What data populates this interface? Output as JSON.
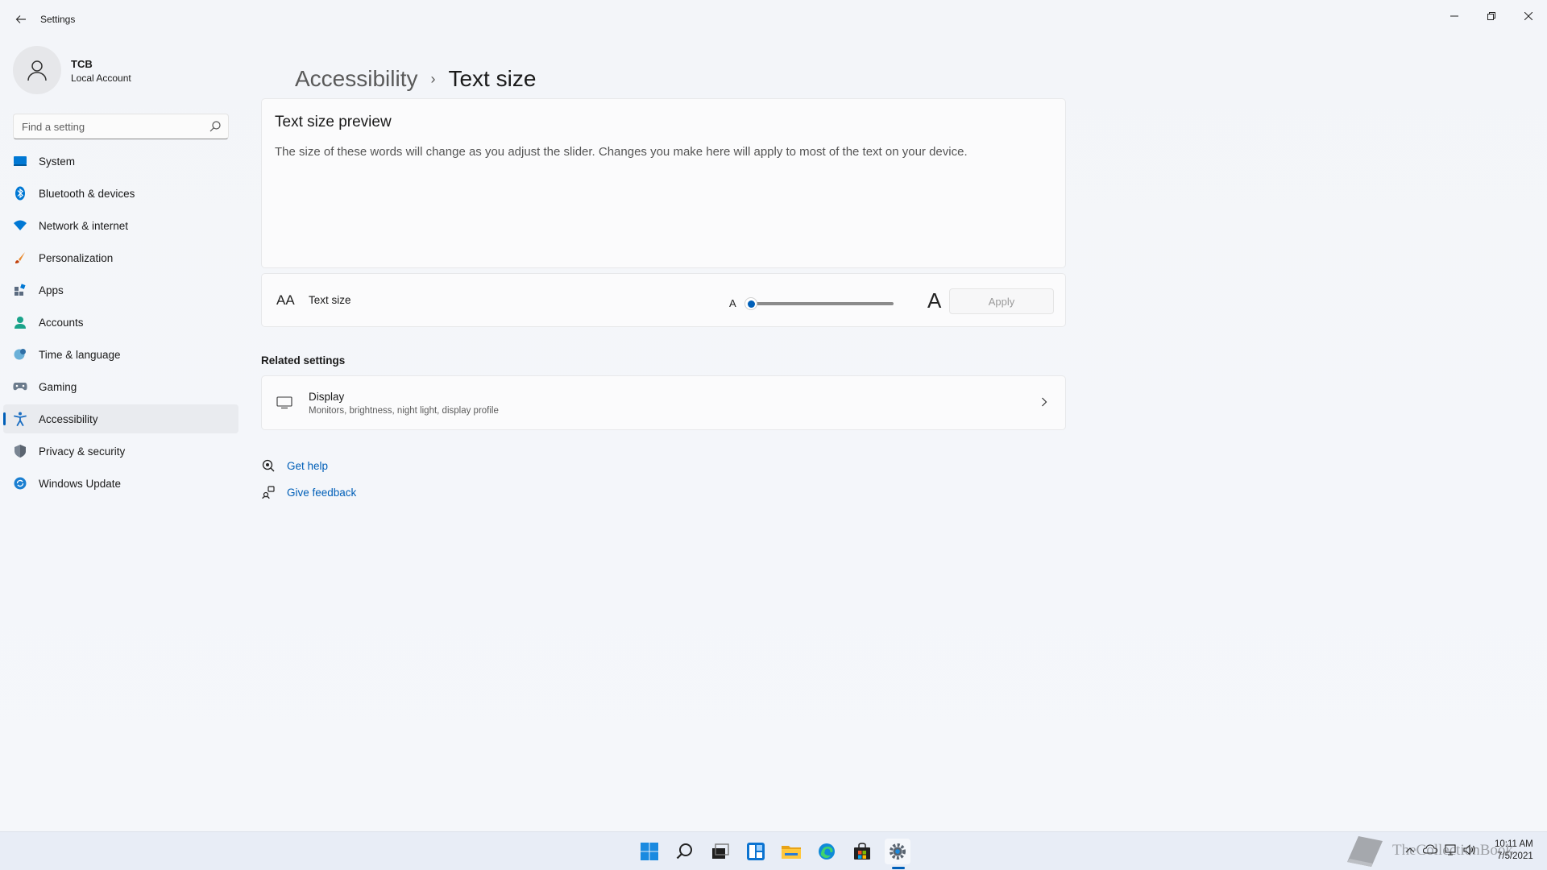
{
  "window": {
    "app_title": "Settings"
  },
  "profile": {
    "name": "TCB",
    "account_type": "Local Account"
  },
  "search": {
    "placeholder": "Find a setting"
  },
  "sidebar": {
    "items": [
      {
        "label": "System",
        "icon": "system-icon"
      },
      {
        "label": "Bluetooth & devices",
        "icon": "bluetooth-icon"
      },
      {
        "label": "Network & internet",
        "icon": "wifi-icon"
      },
      {
        "label": "Personalization",
        "icon": "brush-icon"
      },
      {
        "label": "Apps",
        "icon": "apps-icon"
      },
      {
        "label": "Accounts",
        "icon": "person-icon"
      },
      {
        "label": "Time & language",
        "icon": "globe-clock-icon"
      },
      {
        "label": "Gaming",
        "icon": "gamepad-icon"
      },
      {
        "label": "Accessibility",
        "icon": "accessibility-icon",
        "active": true
      },
      {
        "label": "Privacy & security",
        "icon": "shield-icon"
      },
      {
        "label": "Windows Update",
        "icon": "update-icon"
      }
    ]
  },
  "breadcrumb": {
    "parent": "Accessibility",
    "separator": "›",
    "current": "Text size"
  },
  "preview": {
    "title": "Text size preview",
    "text": "The size of these words will change as you adjust the slider. Changes you make here will apply to most of the text on your device."
  },
  "text_size": {
    "icon_glyph": "AA",
    "label": "Text size",
    "slider_min_glyph": "A",
    "slider_max_glyph": "A",
    "slider_value_fraction": 0.0,
    "apply_label": "Apply"
  },
  "related": {
    "heading": "Related settings",
    "display": {
      "title": "Display",
      "subtitle": "Monitors, brightness, night light, display profile"
    }
  },
  "help": {
    "get_help": "Get help",
    "give_feedback": "Give feedback"
  },
  "taskbar": {
    "apps": [
      "start-icon",
      "search-icon",
      "task-view-icon",
      "widgets-icon",
      "file-explorer-icon",
      "edge-icon",
      "store-icon",
      "settings-icon"
    ],
    "active_app": "settings-icon",
    "time": "10:11 AM",
    "date": "7/5/2021"
  },
  "watermark": {
    "text": "TheCollectionBook"
  },
  "colors": {
    "accent": "#005fb8",
    "background": "#f3f5f9",
    "card": "#fbfbfc"
  }
}
